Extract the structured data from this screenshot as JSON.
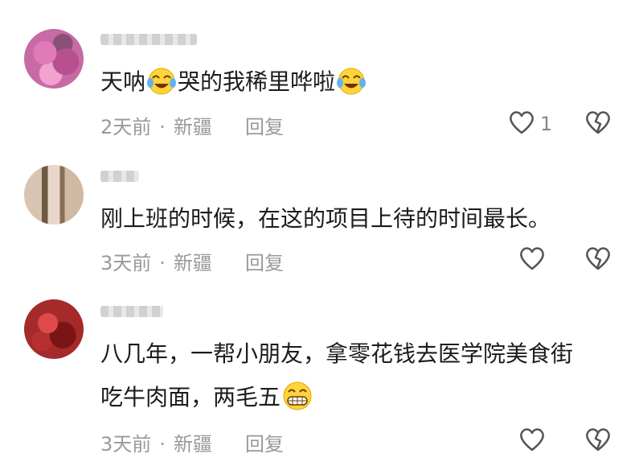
{
  "comments": [
    {
      "text_parts": [
        "天呐",
        "哭的我稀里哗啦"
      ],
      "time": "2天前",
      "dot": "·",
      "location": "新疆",
      "reply_label": "回复",
      "like_count": "1"
    },
    {
      "text": "刚上班的时候，在这的项目上待的时间最长。",
      "time": "3天前",
      "dot": "·",
      "location": "新疆",
      "reply_label": "回复",
      "like_count": ""
    },
    {
      "line1": "八几年，一帮小朋友，拿零花钱去医学院美食街",
      "line2": "吃牛肉面，两毛五",
      "time": "3天前",
      "dot": "·",
      "location": "新疆",
      "reply_label": "回复",
      "like_count": ""
    }
  ],
  "icons": {
    "like": "heart-outline-icon",
    "dislike": "broken-heart-icon",
    "emoji_cry_laugh": "tears-of-joy-emoji",
    "emoji_grin": "grinning-emoji"
  },
  "colors": {
    "text": "#1c1c1c",
    "meta": "#999999",
    "icon": "#555555"
  }
}
